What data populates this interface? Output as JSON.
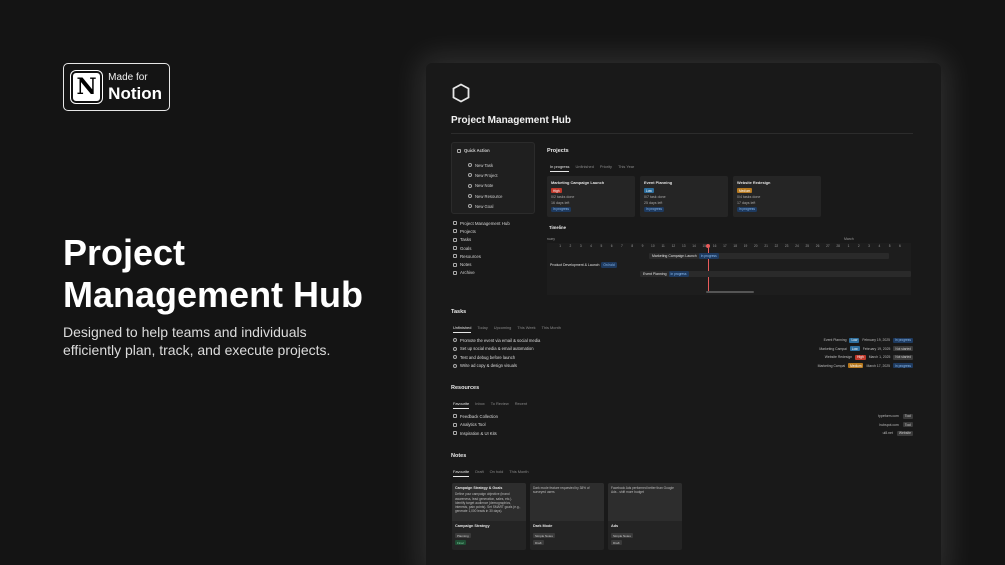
{
  "badge": {
    "line1": "Made for",
    "line2": "Notion",
    "logo_letter": "N"
  },
  "hero": {
    "title": "Project Management Hub",
    "subtitle": "Designed to help teams and individuals efficiently plan, track, and execute projects."
  },
  "window": {
    "icon": "hexagon-icon",
    "title": "Project Management Hub",
    "quick_action": {
      "label": "Quick Action",
      "items": [
        "New Task",
        "New Project",
        "New Note",
        "New Resource",
        "New Goal"
      ]
    },
    "nav": [
      "Project Management Hub",
      "Projects",
      "Tasks",
      "Goals",
      "Resources",
      "Notes",
      "Archive"
    ]
  },
  "projects": {
    "title": "Projects",
    "tabs": [
      "In progress",
      "Unfinished",
      "Priority",
      "This Year"
    ],
    "cards": [
      {
        "title": "Marketing Campaign Launch",
        "priority": "High",
        "priority_color": "#c0392b",
        "tasks_done": "0/2 tasks done",
        "days_left": "16 days left",
        "status": "In progress"
      },
      {
        "title": "Event Planning",
        "priority": "Low",
        "priority_color": "#2e6f9e",
        "tasks_done": "0/7 task done",
        "days_left": "25 days left",
        "status": "In progress"
      },
      {
        "title": "Website Redesign",
        "priority": "Medium",
        "priority_color": "#b7791f",
        "tasks_done": "0/4 tasks done",
        "days_left": "17 days left",
        "status": "In progress"
      }
    ]
  },
  "timeline": {
    "title": "Timeline",
    "month_left": "ruary",
    "month_right": "March",
    "days": [
      "1",
      "2",
      "3",
      "4",
      "5",
      "6",
      "7",
      "8",
      "9",
      "10",
      "11",
      "12",
      "13",
      "14",
      "15",
      "16",
      "17",
      "18",
      "19",
      "20",
      "21",
      "22",
      "23",
      "24",
      "25",
      "26",
      "27",
      "28",
      "1",
      "2",
      "3",
      "4",
      "5",
      "6"
    ],
    "bars": [
      {
        "label": "Marketing Campaign Launch",
        "status": "In progress"
      },
      {
        "label": "Product Development & Launch",
        "status": "On hold"
      },
      {
        "label": "Event Planning",
        "status": "In progress"
      }
    ]
  },
  "tasks": {
    "title": "Tasks",
    "tabs": [
      "Unfinished",
      "Today",
      "Upcoming",
      "This Week",
      "This Month"
    ],
    "items": [
      {
        "text": "Promote the event via email & social media",
        "project": "Event Planning",
        "priority": "Low",
        "priority_color": "#2e6f9e",
        "date": "February 19, 2025",
        "status": "In progress",
        "status_bg": "#1e3a5f",
        "status_fg": "#8fbff3"
      },
      {
        "text": "Set up social media & email automation",
        "project": "Marketing Campai",
        "priority": "Low",
        "priority_color": "#2e6f9e",
        "date": "February 19, 2025",
        "status": "Not started",
        "status_bg": "#3a3a3a",
        "status_fg": "#cfcfcf"
      },
      {
        "text": "Test and debug before launch",
        "project": "Website Redesign",
        "priority": "High",
        "priority_color": "#c0392b",
        "date": "March 1, 2025",
        "status": "Not started",
        "status_bg": "#3a3a3a",
        "status_fg": "#cfcfcf"
      },
      {
        "text": "Write ad copy & design visuals",
        "project": "Marketing Campai",
        "priority": "Medium",
        "priority_color": "#b7791f",
        "date": "March 17, 2025",
        "status": "In progress",
        "status_bg": "#1e3a5f",
        "status_fg": "#8fbff3"
      }
    ]
  },
  "resources": {
    "title": "Resources",
    "tabs": [
      "Favourite",
      "Inbox",
      "To Review",
      "Recent"
    ],
    "items": [
      {
        "text": "Feedback Collection",
        "domain": "typeform.com",
        "type": "Tool"
      },
      {
        "text": "Analytics Tool",
        "domain": "hubspot.com",
        "type": "Tool"
      },
      {
        "text": "Inspiration & UI Kits",
        "domain": "ui8.net",
        "type": "Website"
      }
    ]
  },
  "notes": {
    "title": "Notes",
    "tabs": [
      "Favourite",
      "Draft",
      "On hold",
      "This Month"
    ],
    "cards": [
      {
        "preview_title": "Campaign Strategy & Goals",
        "preview": "Define your campaign objective (brand awareness, lead generation, sales, etc.). Identify target audience (demographics, interests, pain points). Set SMART goals (e.g., generate 1,000 leads in 30 days).",
        "title": "Campaign Strategy",
        "tag": "Planning",
        "tag_bg": "#3a3a3a",
        "status": "Final",
        "status_bg": "#1f4d33",
        "status_fg": "#7fd6a4"
      },
      {
        "preview_title": "",
        "preview": "Dark mode feature requested by 38% of surveyed users",
        "title": "Dark Mode",
        "tag": "Simple Notes",
        "tag_bg": "#3a3a3a",
        "status": "Draft",
        "status_bg": "#3a3a3a",
        "status_fg": "#cfcfcf"
      },
      {
        "preview_title": "",
        "preview": "Facebook Ads performed better than Google Ads - shift more budget",
        "title": "Ads",
        "tag": "Simple Notes",
        "tag_bg": "#3a3a3a",
        "status": "Draft",
        "status_bg": "#3a3a3a",
        "status_fg": "#cfcfcf"
      }
    ]
  }
}
